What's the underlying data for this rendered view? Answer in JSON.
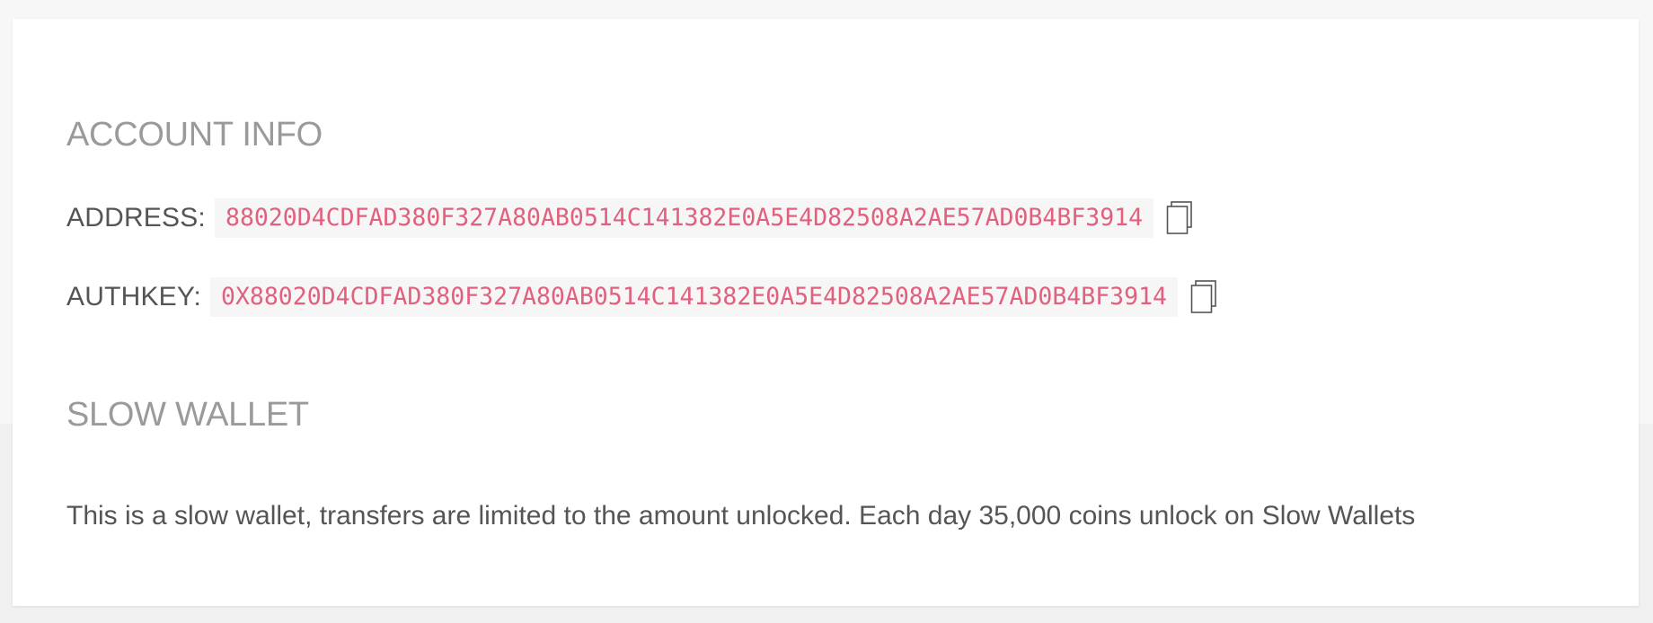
{
  "account_info": {
    "title": "ACCOUNT INFO",
    "address": {
      "label": "ADDRESS:",
      "value": "88020D4CDFAD380F327A80AB0514C141382E0A5E4D82508A2AE57AD0B4BF3914",
      "copy_icon": "copy-icon"
    },
    "authkey": {
      "label": "AUTHKEY:",
      "value": "0X88020D4CDFAD380F327A80AB0514C141382E0A5E4D82508A2AE57AD0B4BF3914",
      "copy_icon": "copy-icon"
    }
  },
  "slow_wallet": {
    "title": "SLOW WALLET",
    "description": "This is a slow wallet, transfers are limited to the amount unlocked. Each day 35,000 coins unlock on Slow Wallets"
  },
  "colors": {
    "value_text": "#e0607e",
    "value_bg": "#f6f6f6",
    "title_text": "#9a9a9a",
    "label_text": "#555555"
  }
}
